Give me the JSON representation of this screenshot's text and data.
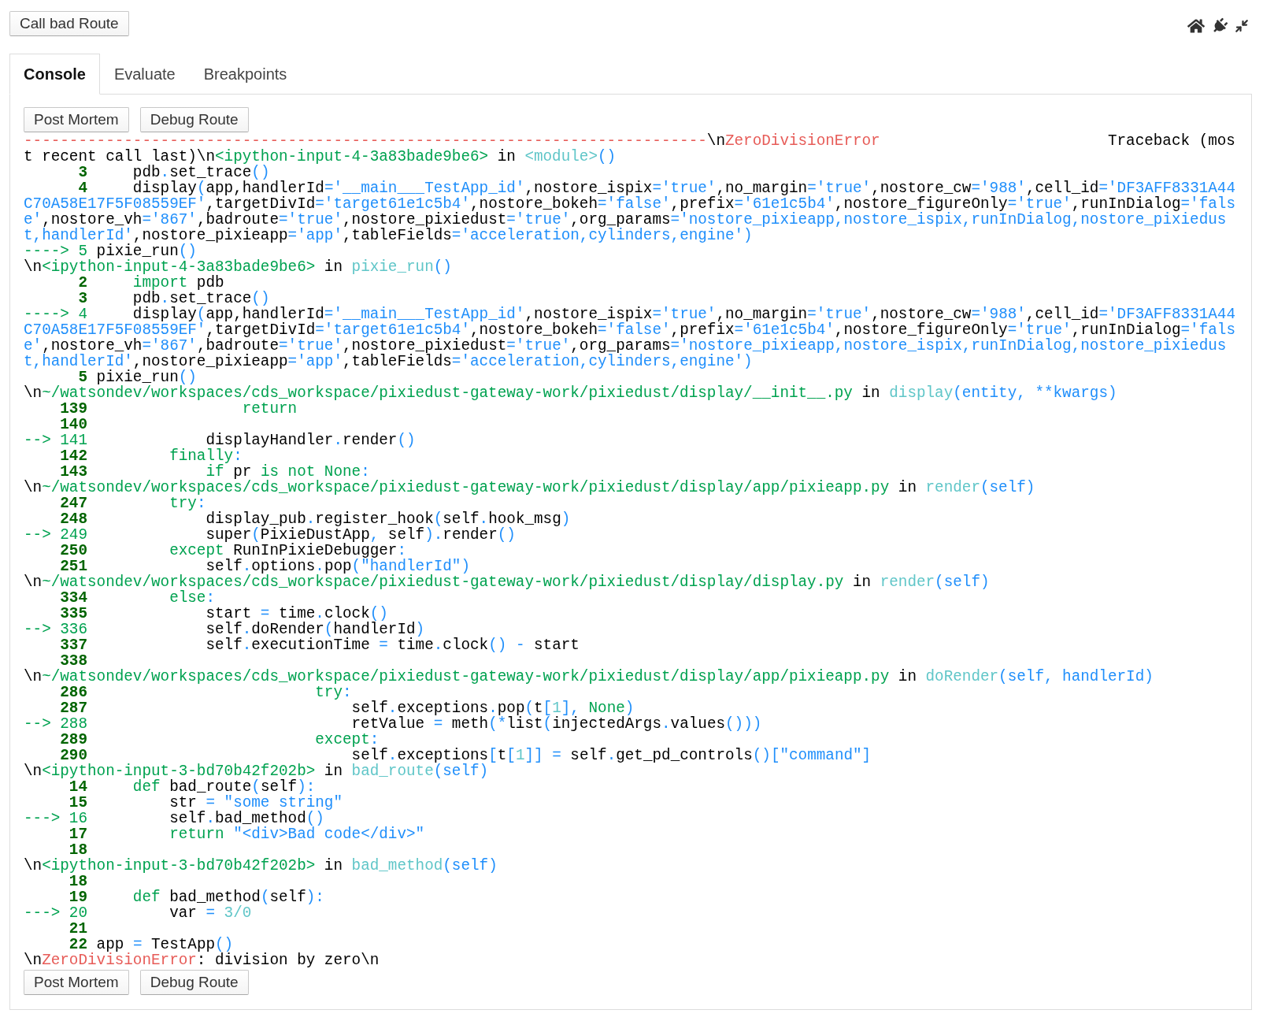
{
  "top_button": "Call bad Route",
  "tabs": [
    {
      "label": "Console",
      "selected": true
    },
    {
      "label": "Evaluate",
      "selected": false
    },
    {
      "label": "Breakpoints",
      "selected": false
    }
  ],
  "console": {
    "buttons_top": [
      "Post Mortem",
      "Debug Route"
    ],
    "traceback": [
      [
        {
          "kind": "error",
          "text": "---------------------------------------------------------------------------"
        },
        {
          "kind": "plain",
          "text": "\\n"
        },
        {
          "kind": "error",
          "text": "ZeroDivisionError"
        },
        {
          "kind": "plain",
          "text": "                         Traceback (most recent call last)\\n"
        },
        {
          "kind": "file",
          "text": "<ipython-input-4-3a83bade9be6>"
        },
        {
          "kind": "plain",
          "text": " in "
        },
        {
          "kind": "func",
          "text": "<module>"
        },
        {
          "kind": "op",
          "text": "()"
        }
      ],
      [
        {
          "kind": "lineno",
          "text": "      3"
        },
        {
          "kind": "plain",
          "text": "     pdb"
        },
        {
          "kind": "op",
          "text": "."
        },
        {
          "kind": "plain",
          "text": "set_trace"
        },
        {
          "kind": "op",
          "text": "()"
        }
      ],
      [
        {
          "kind": "lineno",
          "text": "      4"
        },
        {
          "kind": "plain",
          "text": "     display"
        },
        {
          "kind": "op",
          "text": "("
        },
        {
          "kind": "plain",
          "text": "app,handlerId"
        },
        {
          "kind": "op",
          "text": "='__main___TestApp_id'"
        },
        {
          "kind": "plain",
          "text": ",nostore_ispix"
        },
        {
          "kind": "op",
          "text": "='true'"
        },
        {
          "kind": "plain",
          "text": ",no_margin"
        },
        {
          "kind": "op",
          "text": "='true'"
        },
        {
          "kind": "plain",
          "text": ",nostore_cw"
        },
        {
          "kind": "op",
          "text": "='988'"
        },
        {
          "kind": "plain",
          "text": ",cell_id"
        },
        {
          "kind": "op",
          "text": "='DF3AFF8331A44C70A58E17F5F08559EF'"
        },
        {
          "kind": "plain",
          "text": ",targetDivId"
        },
        {
          "kind": "op",
          "text": "='target61e1c5b4'"
        },
        {
          "kind": "plain",
          "text": ",nostore_bokeh"
        },
        {
          "kind": "op",
          "text": "='false'"
        },
        {
          "kind": "plain",
          "text": ",prefix"
        },
        {
          "kind": "op",
          "text": "='61e1c5b4'"
        },
        {
          "kind": "plain",
          "text": ",nostore_figureOnly"
        },
        {
          "kind": "op",
          "text": "='true'"
        },
        {
          "kind": "plain",
          "text": ",runInDialog"
        },
        {
          "kind": "op",
          "text": "='false'"
        },
        {
          "kind": "plain",
          "text": ",nostore_vh"
        },
        {
          "kind": "op",
          "text": "='867'"
        },
        {
          "kind": "plain",
          "text": ",badroute"
        },
        {
          "kind": "op",
          "text": "='true'"
        },
        {
          "kind": "plain",
          "text": ",nostore_pixiedust"
        },
        {
          "kind": "op",
          "text": "='true'"
        },
        {
          "kind": "plain",
          "text": ",org_params"
        },
        {
          "kind": "op",
          "text": "='nostore_pixieapp,nostore_ispix,runInDialog,nostore_pixiedust,handlerId'"
        },
        {
          "kind": "plain",
          "text": ",nostore_pixieapp"
        },
        {
          "kind": "op",
          "text": "='app'"
        },
        {
          "kind": "plain",
          "text": ",tableFields"
        },
        {
          "kind": "op",
          "text": "='acceleration,cylinders,engine')"
        }
      ],
      [
        {
          "kind": "arrow",
          "text": "----> 5"
        },
        {
          "kind": "plain",
          "text": " pixie_run"
        },
        {
          "kind": "op",
          "text": "()"
        }
      ],
      [
        {
          "kind": "plain",
          "text": "\\n"
        },
        {
          "kind": "file",
          "text": "<ipython-input-4-3a83bade9be6>"
        },
        {
          "kind": "plain",
          "text": " in "
        },
        {
          "kind": "func",
          "text": "pixie_run"
        },
        {
          "kind": "op",
          "text": "()"
        }
      ],
      [
        {
          "kind": "lineno",
          "text": "      2"
        },
        {
          "kind": "kw",
          "text": "     import"
        },
        {
          "kind": "plain",
          "text": " pdb"
        }
      ],
      [
        {
          "kind": "lineno",
          "text": "      3"
        },
        {
          "kind": "plain",
          "text": "     pdb"
        },
        {
          "kind": "op",
          "text": "."
        },
        {
          "kind": "plain",
          "text": "set_trace"
        },
        {
          "kind": "op",
          "text": "()"
        }
      ],
      [
        {
          "kind": "arrow",
          "text": "----> 4"
        },
        {
          "kind": "plain",
          "text": "     display"
        },
        {
          "kind": "op",
          "text": "("
        },
        {
          "kind": "plain",
          "text": "app,handlerId"
        },
        {
          "kind": "op",
          "text": "='__main___TestApp_id'"
        },
        {
          "kind": "plain",
          "text": ",nostore_ispix"
        },
        {
          "kind": "op",
          "text": "='true'"
        },
        {
          "kind": "plain",
          "text": ",no_margin"
        },
        {
          "kind": "op",
          "text": "='true'"
        },
        {
          "kind": "plain",
          "text": ",nostore_cw"
        },
        {
          "kind": "op",
          "text": "='988'"
        },
        {
          "kind": "plain",
          "text": ",cell_id"
        },
        {
          "kind": "op",
          "text": "='DF3AFF8331A44C70A58E17F5F08559EF'"
        },
        {
          "kind": "plain",
          "text": ",targetDivId"
        },
        {
          "kind": "op",
          "text": "='target61e1c5b4'"
        },
        {
          "kind": "plain",
          "text": ",nostore_bokeh"
        },
        {
          "kind": "op",
          "text": "='false'"
        },
        {
          "kind": "plain",
          "text": ",prefix"
        },
        {
          "kind": "op",
          "text": "='61e1c5b4'"
        },
        {
          "kind": "plain",
          "text": ",nostore_figureOnly"
        },
        {
          "kind": "op",
          "text": "='true'"
        },
        {
          "kind": "plain",
          "text": ",runInDialog"
        },
        {
          "kind": "op",
          "text": "='false'"
        },
        {
          "kind": "plain",
          "text": ",nostore_vh"
        },
        {
          "kind": "op",
          "text": "='867'"
        },
        {
          "kind": "plain",
          "text": ",badroute"
        },
        {
          "kind": "op",
          "text": "='true'"
        },
        {
          "kind": "plain",
          "text": ",nostore_pixiedust"
        },
        {
          "kind": "op",
          "text": "='true'"
        },
        {
          "kind": "plain",
          "text": ",org_params"
        },
        {
          "kind": "op",
          "text": "='nostore_pixieapp,nostore_ispix,runInDialog,nostore_pixiedust,handlerId'"
        },
        {
          "kind": "plain",
          "text": ",nostore_pixieapp"
        },
        {
          "kind": "op",
          "text": "='app'"
        },
        {
          "kind": "plain",
          "text": ",tableFields"
        },
        {
          "kind": "op",
          "text": "='acceleration,cylinders,engine')"
        }
      ],
      [
        {
          "kind": "lineno",
          "text": "      5"
        },
        {
          "kind": "plain",
          "text": " pixie_run"
        },
        {
          "kind": "op",
          "text": "()"
        }
      ],
      [
        {
          "kind": "plain",
          "text": "\\n"
        },
        {
          "kind": "file",
          "text": "~/watsondev/workspaces/cds_workspace/pixiedust-gateway-work/pixiedust/display/__init__.py"
        },
        {
          "kind": "plain",
          "text": " in "
        },
        {
          "kind": "func",
          "text": "display"
        },
        {
          "kind": "op",
          "text": "(entity, **kwargs)"
        }
      ],
      [
        {
          "kind": "lineno",
          "text": "    139"
        },
        {
          "kind": "kw",
          "text": "                 return"
        }
      ],
      [
        {
          "kind": "lineno",
          "text": "    140"
        }
      ],
      [
        {
          "kind": "arrow",
          "text": "--> 141"
        },
        {
          "kind": "plain",
          "text": "             displayHandler"
        },
        {
          "kind": "op",
          "text": "."
        },
        {
          "kind": "plain",
          "text": "render"
        },
        {
          "kind": "op",
          "text": "()"
        }
      ],
      [
        {
          "kind": "lineno",
          "text": "    142"
        },
        {
          "kind": "kw",
          "text": "         finally"
        },
        {
          "kind": "op",
          "text": ":"
        }
      ],
      [
        {
          "kind": "lineno",
          "text": "    143"
        },
        {
          "kind": "kw",
          "text": "             if"
        },
        {
          "kind": "plain",
          "text": " pr "
        },
        {
          "kind": "kw",
          "text": "is not None"
        },
        {
          "kind": "op",
          "text": ":"
        }
      ],
      [
        {
          "kind": "plain",
          "text": "\\n"
        },
        {
          "kind": "file",
          "text": "~/watsondev/workspaces/cds_workspace/pixiedust-gateway-work/pixiedust/display/app/pixieapp.py"
        },
        {
          "kind": "plain",
          "text": " in "
        },
        {
          "kind": "func",
          "text": "render"
        },
        {
          "kind": "op",
          "text": "(self)"
        }
      ],
      [
        {
          "kind": "lineno",
          "text": "    247"
        },
        {
          "kind": "kw",
          "text": "         try"
        },
        {
          "kind": "op",
          "text": ":"
        }
      ],
      [
        {
          "kind": "lineno",
          "text": "    248"
        },
        {
          "kind": "plain",
          "text": "             display_pub"
        },
        {
          "kind": "op",
          "text": "."
        },
        {
          "kind": "plain",
          "text": "register_hook"
        },
        {
          "kind": "op",
          "text": "("
        },
        {
          "kind": "plain",
          "text": "self"
        },
        {
          "kind": "op",
          "text": "."
        },
        {
          "kind": "plain",
          "text": "hook_msg"
        },
        {
          "kind": "op",
          "text": ")"
        }
      ],
      [
        {
          "kind": "arrow",
          "text": "--> 249"
        },
        {
          "kind": "plain",
          "text": "             super"
        },
        {
          "kind": "op",
          "text": "("
        },
        {
          "kind": "plain",
          "text": "PixieDustApp"
        },
        {
          "kind": "op",
          "text": ","
        },
        {
          "kind": "plain",
          "text": " self"
        },
        {
          "kind": "op",
          "text": ")."
        },
        {
          "kind": "plain",
          "text": "render"
        },
        {
          "kind": "op",
          "text": "()"
        }
      ],
      [
        {
          "kind": "lineno",
          "text": "    250"
        },
        {
          "kind": "kw",
          "text": "         except"
        },
        {
          "kind": "plain",
          "text": " RunInPixieDebugger"
        },
        {
          "kind": "op",
          "text": ":"
        }
      ],
      [
        {
          "kind": "lineno",
          "text": "    251"
        },
        {
          "kind": "plain",
          "text": "             self"
        },
        {
          "kind": "op",
          "text": "."
        },
        {
          "kind": "plain",
          "text": "options"
        },
        {
          "kind": "op",
          "text": "."
        },
        {
          "kind": "plain",
          "text": "pop"
        },
        {
          "kind": "op",
          "text": "(\"handlerId\")"
        }
      ],
      [
        {
          "kind": "plain",
          "text": "\\n"
        },
        {
          "kind": "file",
          "text": "~/watsondev/workspaces/cds_workspace/pixiedust-gateway-work/pixiedust/display/display.py"
        },
        {
          "kind": "plain",
          "text": " in "
        },
        {
          "kind": "func",
          "text": "render"
        },
        {
          "kind": "op",
          "text": "(self)"
        }
      ],
      [
        {
          "kind": "lineno",
          "text": "    334"
        },
        {
          "kind": "kw",
          "text": "         else"
        },
        {
          "kind": "op",
          "text": ":"
        }
      ],
      [
        {
          "kind": "lineno",
          "text": "    335"
        },
        {
          "kind": "plain",
          "text": "             start "
        },
        {
          "kind": "op",
          "text": "="
        },
        {
          "kind": "plain",
          "text": " time"
        },
        {
          "kind": "op",
          "text": "."
        },
        {
          "kind": "plain",
          "text": "clock"
        },
        {
          "kind": "op",
          "text": "()"
        }
      ],
      [
        {
          "kind": "arrow",
          "text": "--> 336"
        },
        {
          "kind": "plain",
          "text": "             self"
        },
        {
          "kind": "op",
          "text": "."
        },
        {
          "kind": "plain",
          "text": "doRender"
        },
        {
          "kind": "op",
          "text": "("
        },
        {
          "kind": "plain",
          "text": "handlerId"
        },
        {
          "kind": "op",
          "text": ")"
        }
      ],
      [
        {
          "kind": "lineno",
          "text": "    337"
        },
        {
          "kind": "plain",
          "text": "             self"
        },
        {
          "kind": "op",
          "text": "."
        },
        {
          "kind": "plain",
          "text": "executionTime "
        },
        {
          "kind": "op",
          "text": "="
        },
        {
          "kind": "plain",
          "text": " time"
        },
        {
          "kind": "op",
          "text": "."
        },
        {
          "kind": "plain",
          "text": "clock"
        },
        {
          "kind": "op",
          "text": "() -"
        },
        {
          "kind": "plain",
          "text": " start"
        }
      ],
      [
        {
          "kind": "lineno",
          "text": "    338"
        }
      ],
      [
        {
          "kind": "plain",
          "text": "\\n"
        },
        {
          "kind": "file",
          "text": "~/watsondev/workspaces/cds_workspace/pixiedust-gateway-work/pixiedust/display/app/pixieapp.py"
        },
        {
          "kind": "plain",
          "text": " in "
        },
        {
          "kind": "func",
          "text": "doRender"
        },
        {
          "kind": "op",
          "text": "(self, handlerId)"
        }
      ],
      [
        {
          "kind": "lineno",
          "text": "    286"
        },
        {
          "kind": "kw",
          "text": "                         try"
        },
        {
          "kind": "op",
          "text": ":"
        }
      ],
      [
        {
          "kind": "lineno",
          "text": "    287"
        },
        {
          "kind": "plain",
          "text": "                             self"
        },
        {
          "kind": "op",
          "text": "."
        },
        {
          "kind": "plain",
          "text": "exceptions"
        },
        {
          "kind": "op",
          "text": "."
        },
        {
          "kind": "plain",
          "text": "pop"
        },
        {
          "kind": "op",
          "text": "("
        },
        {
          "kind": "plain",
          "text": "t"
        },
        {
          "kind": "op",
          "text": "["
        },
        {
          "kind": "num",
          "text": "1"
        },
        {
          "kind": "op",
          "text": "],"
        },
        {
          "kind": "kw",
          "text": " None"
        },
        {
          "kind": "op",
          "text": ")"
        }
      ],
      [
        {
          "kind": "arrow",
          "text": "--> 288"
        },
        {
          "kind": "plain",
          "text": "                             retValue "
        },
        {
          "kind": "op",
          "text": "="
        },
        {
          "kind": "plain",
          "text": " meth"
        },
        {
          "kind": "op",
          "text": "(*"
        },
        {
          "kind": "plain",
          "text": "list"
        },
        {
          "kind": "op",
          "text": "("
        },
        {
          "kind": "plain",
          "text": "injectedArgs"
        },
        {
          "kind": "op",
          "text": "."
        },
        {
          "kind": "plain",
          "text": "values"
        },
        {
          "kind": "op",
          "text": "()))"
        }
      ],
      [
        {
          "kind": "lineno",
          "text": "    289"
        },
        {
          "kind": "kw",
          "text": "                         except"
        },
        {
          "kind": "op",
          "text": ":"
        }
      ],
      [
        {
          "kind": "lineno",
          "text": "    290"
        },
        {
          "kind": "plain",
          "text": "                             self"
        },
        {
          "kind": "op",
          "text": "."
        },
        {
          "kind": "plain",
          "text": "exceptions"
        },
        {
          "kind": "op",
          "text": "["
        },
        {
          "kind": "plain",
          "text": "t"
        },
        {
          "kind": "op",
          "text": "["
        },
        {
          "kind": "num",
          "text": "1"
        },
        {
          "kind": "op",
          "text": "]] ="
        },
        {
          "kind": "plain",
          "text": " self"
        },
        {
          "kind": "op",
          "text": "."
        },
        {
          "kind": "plain",
          "text": "get_pd_controls"
        },
        {
          "kind": "op",
          "text": "()[\"command\"]"
        }
      ],
      [
        {
          "kind": "plain",
          "text": "\\n"
        },
        {
          "kind": "file",
          "text": "<ipython-input-3-bd70b42f202b>"
        },
        {
          "kind": "plain",
          "text": " in "
        },
        {
          "kind": "func",
          "text": "bad_route"
        },
        {
          "kind": "op",
          "text": "(self)"
        }
      ],
      [
        {
          "kind": "lineno",
          "text": "     14"
        },
        {
          "kind": "kw",
          "text": "     def"
        },
        {
          "kind": "plain",
          "text": " bad_route"
        },
        {
          "kind": "op",
          "text": "("
        },
        {
          "kind": "plain",
          "text": "self"
        },
        {
          "kind": "op",
          "text": "):"
        }
      ],
      [
        {
          "kind": "lineno",
          "text": "     15"
        },
        {
          "kind": "plain",
          "text": "         str "
        },
        {
          "kind": "op",
          "text": "= \"some string\""
        }
      ],
      [
        {
          "kind": "arrow",
          "text": "---> 16"
        },
        {
          "kind": "plain",
          "text": "         self"
        },
        {
          "kind": "op",
          "text": "."
        },
        {
          "kind": "plain",
          "text": "bad_method"
        },
        {
          "kind": "op",
          "text": "()"
        }
      ],
      [
        {
          "kind": "lineno",
          "text": "     17"
        },
        {
          "kind": "kw",
          "text": "         return"
        },
        {
          "kind": "op",
          "text": " \"<div>Bad code</div>\""
        }
      ],
      [
        {
          "kind": "lineno",
          "text": "     18"
        }
      ],
      [
        {
          "kind": "plain",
          "text": "\\n"
        },
        {
          "kind": "file",
          "text": "<ipython-input-3-bd70b42f202b>"
        },
        {
          "kind": "plain",
          "text": " in "
        },
        {
          "kind": "func",
          "text": "bad_method"
        },
        {
          "kind": "op",
          "text": "(self)"
        }
      ],
      [
        {
          "kind": "lineno",
          "text": "     18"
        }
      ],
      [
        {
          "kind": "lineno",
          "text": "     19"
        },
        {
          "kind": "kw",
          "text": "     def"
        },
        {
          "kind": "plain",
          "text": " bad_method"
        },
        {
          "kind": "op",
          "text": "("
        },
        {
          "kind": "plain",
          "text": "self"
        },
        {
          "kind": "op",
          "text": "):"
        }
      ],
      [
        {
          "kind": "arrow",
          "text": "---> 20"
        },
        {
          "kind": "plain",
          "text": "         var "
        },
        {
          "kind": "op",
          "text": "="
        },
        {
          "kind": "num",
          "text": " 3/0"
        }
      ],
      [
        {
          "kind": "lineno",
          "text": "     21"
        }
      ],
      [
        {
          "kind": "lineno",
          "text": "     22"
        },
        {
          "kind": "plain",
          "text": " app "
        },
        {
          "kind": "op",
          "text": "="
        },
        {
          "kind": "plain",
          "text": " TestApp"
        },
        {
          "kind": "op",
          "text": "()"
        }
      ],
      [
        {
          "kind": "plain",
          "text": "\\n"
        },
        {
          "kind": "error",
          "text": "ZeroDivisionError"
        },
        {
          "kind": "plain",
          "text": ": division by zero\\n"
        }
      ]
    ],
    "buttons_bottom": [
      "Post Mortem",
      "Debug Route"
    ]
  }
}
